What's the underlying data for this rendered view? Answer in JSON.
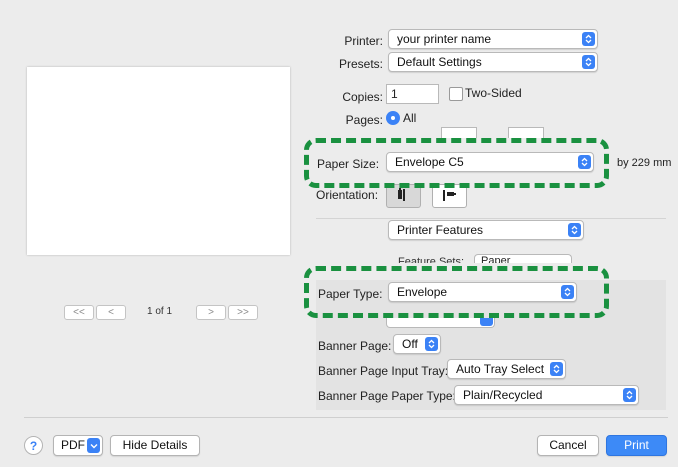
{
  "printer": {
    "label": "Printer:",
    "value": "your printer name"
  },
  "presets": {
    "label": "Presets:",
    "value": "Default Settings"
  },
  "copies": {
    "label": "Copies:",
    "value": "1",
    "two_sided_label": "Two-Sided"
  },
  "pages": {
    "label": "Pages:",
    "all_label": "All"
  },
  "paper_size": {
    "label": "Paper Size:",
    "value": "Envelope C5",
    "dimension_text": "by 229 mm"
  },
  "orientation": {
    "label": "Orientation:"
  },
  "section": {
    "value": "Printer Features"
  },
  "feature_sets": {
    "label_partial": "Feature Sets:",
    "value_partial": "Paper"
  },
  "paper_type": {
    "label": "Paper Type:",
    "value": "Envelope"
  },
  "banner_page": {
    "label": "Banner Page:",
    "value": "Off"
  },
  "banner_input_tray": {
    "label": "Banner Page Input Tray:",
    "value": "Auto Tray Select"
  },
  "banner_paper_type": {
    "label": "Banner Page Paper Type:",
    "value": "Plain/Recycled"
  },
  "pager": {
    "text": "1 of 1",
    "first": "<<",
    "prev": "<",
    "next": ">",
    "last": ">>"
  },
  "footer": {
    "help": "?",
    "pdf": "PDF",
    "hide_details": "Hide Details",
    "cancel": "Cancel",
    "print": "Print"
  },
  "colors": {
    "accent": "#3b82f6",
    "highlight": "#1a9140"
  }
}
